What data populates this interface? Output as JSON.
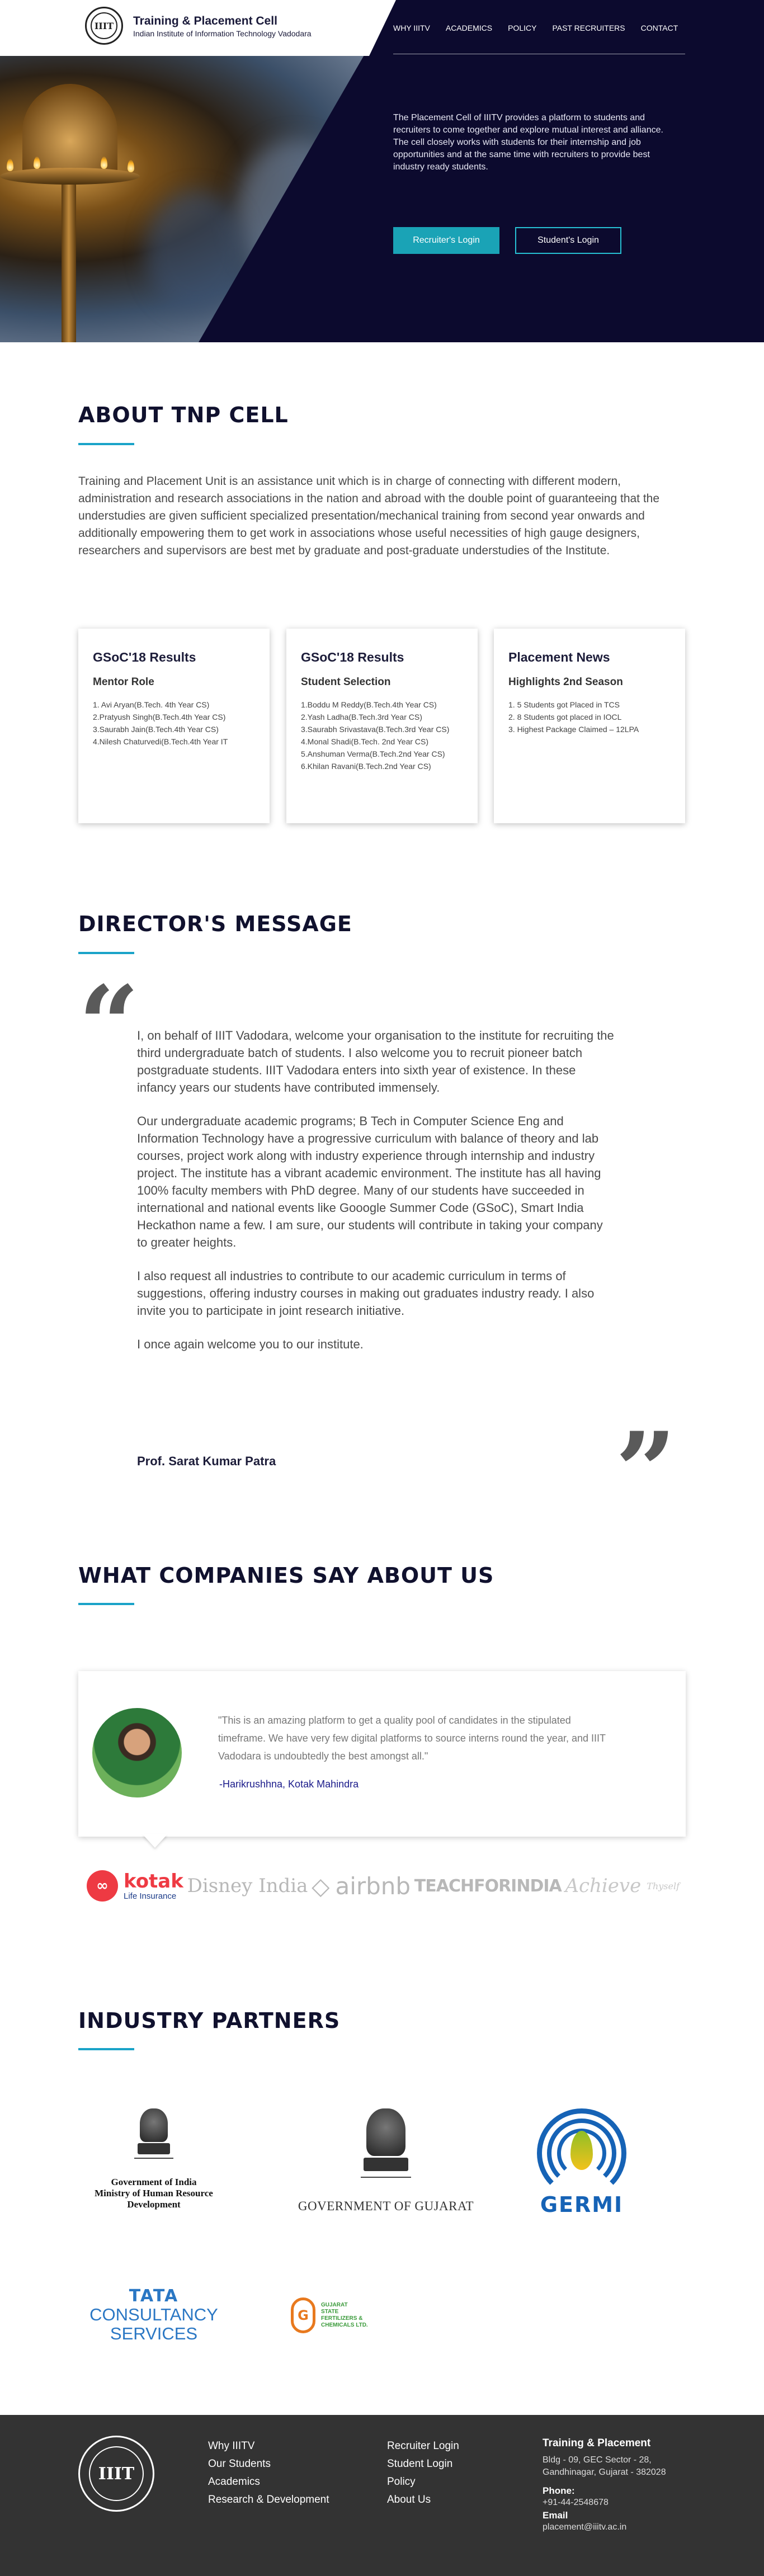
{
  "header": {
    "title": "Training & Placement Cell",
    "subtitle": "Indian Institute of Information Technology Vadodara",
    "logo_text": "IIIT"
  },
  "nav": [
    "WHY IIITV",
    "ACADEMICS",
    "POLICY",
    "PAST RECRUITERS",
    "CONTACT"
  ],
  "hero": {
    "text": "The Placement Cell of IIITV provides a platform to students and recruiters to come together and explore mutual interest and alliance. The cell closely works with students for their internship and job opportunities and at the same time with recruiters to provide best industry ready students.",
    "recruiter_button": "Recruiter's Login",
    "student_button": "Student's Login"
  },
  "about": {
    "title": "ABOUT TNP CELL",
    "text": "Training and Placement Unit is an assistance unit which is in charge of connecting with different modern, administration and research associations in the nation and abroad with the double point of guaranteeing that the understudies are given sufficient specialized presentation/mechanical training from second year onwards and additionally empowering them to get work in associations whose useful necessities of high gauge designers, researchers and supervisors are best met by graduate and post-graduate understudies of the Institute."
  },
  "cards": [
    {
      "title": "GSoC'18 Results",
      "subtitle": "Mentor Role",
      "items": [
        "1. Avi Aryan(B.Tech. 4th Year CS)",
        "2.Pratyush Singh(B.Tech.4th Year CS)",
        "3.Saurabh Jain(B.Tech.4th Year CS)",
        "4.Nilesh Chaturvedi(B.Tech.4th Year IT"
      ]
    },
    {
      "title": "GSoC'18 Results",
      "subtitle": "Student Selection",
      "items": [
        "1.Boddu M Reddy(B.Tech.4th Year CS)",
        "2.Yash Ladha(B.Tech.3rd Year CS)",
        "3.Saurabh Srivastava(B.Tech.3rd Year CS)",
        "4.Monal Shadi(B.Tech. 2nd Year CS)",
        "5.Anshuman Verma(B.Tech.2nd Year CS)",
        "6.Khilan Ravani(B.Tech.2nd Year CS)"
      ]
    },
    {
      "title": "Placement News",
      "subtitle": "Highlights 2nd Season",
      "items": [
        "1. 5 Students got Placed in TCS",
        "2. 8 Students got placed in IOCL",
        "3. Highest Package Claimed – 12LPA"
      ]
    }
  ],
  "director": {
    "title": "DIRECTOR'S MESSAGE",
    "paragraphs": [
      "I, on behalf of IIIT Vadodara, welcome your organisation to the institute for recruiting the third undergraduate batch of students. I also welcome you to recruit pioneer batch postgraduate students. IIIT Vadodara enters into sixth year of existence. In these infancy years our students have contributed immensely.",
      "Our undergraduate academic programs; B Tech in Computer Science Eng and Information Technology have a progressive curriculum with balance of theory and lab courses, project work along with industry experience through internship and industry project. The institute has a vibrant academic environment. The institute has all having 100% faculty members with PhD degree. Many of our students have succeeded in international and national events like Gooogle Summer Code (GSoC), Smart India Heckathon name a few. I am sure, our students will contribute in taking your company to greater heights.",
      "I also request all industries to contribute to our academic curriculum in terms of suggestions, offering industry courses in making out graduates industry ready. I also invite you to participate in joint research initiative.",
      "I once again welcome you to our institute."
    ],
    "signature": "Prof. Sarat Kumar Patra",
    "quote_open": "“",
    "quote_close": "”"
  },
  "companies": {
    "title": "WHAT COMPANIES SAY ABOUT US",
    "testimonial": "\"This is an amazing platform to get a quality pool of candidates in the stipulated timeframe. We have very few digital platforms to source interns round the year, and IIIT Vadodara is undoubtedly the best amongst all.\"",
    "author": "-Harikrushhna, Kotak Mahindra",
    "logos": {
      "kotak": "kotak",
      "kotak_sub": "Life Insurance",
      "disney": "Disney India",
      "airbnb": "airbnb",
      "teach": "TEACHFORINDIA",
      "achieve": "Achieve",
      "achieve_sub": "Thyself"
    }
  },
  "partners": {
    "title": "INDUSTRY PARTNERS",
    "mhrd": [
      "Government of India",
      "Ministry of Human Resource",
      "Development"
    ],
    "gujarat": "GOVERNMENT OF GUJARAT",
    "germi": "GERMI",
    "tcs": [
      "TATA",
      "CONSULTANCY",
      "SERVICES"
    ],
    "gsfc": [
      "GUJARAT",
      "STATE",
      "FERTILIZERS &",
      "CHEMICALS LTD."
    ]
  },
  "footer": {
    "col1": [
      "Why IIITV",
      "Our Students",
      "Academics",
      "Research & Development"
    ],
    "col2": [
      "Recruiter Login",
      "Student Login",
      "Policy",
      "About Us"
    ],
    "contact_title": "Training & Placement",
    "address1": "Bldg - 09, GEC Sector - 28,",
    "address2": "Gandhinagar, Gujarat - 382028",
    "phone_label": "Phone:",
    "phone": "+91-44-2548678",
    "email_label": "Email",
    "email": "placement@iiitv.ac.in"
  }
}
